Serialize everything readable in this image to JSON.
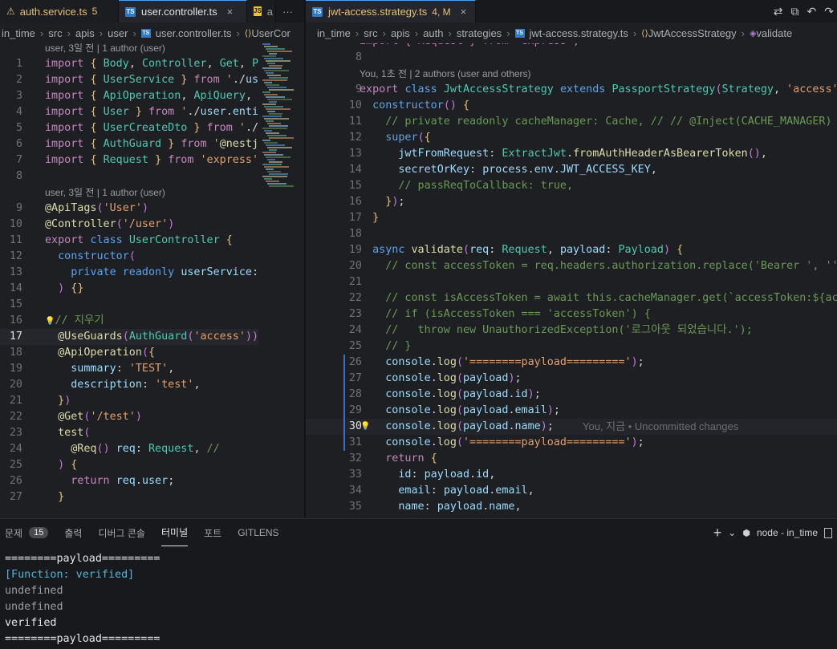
{
  "left_tabs": [
    {
      "name": "auth.service.ts",
      "badge": "5",
      "icon": "ts",
      "color": "#e5c07b"
    },
    {
      "name": "user.controller.ts",
      "icon": "ts",
      "close": "×",
      "active": true
    },
    {
      "name": "a",
      "icon": "js"
    }
  ],
  "left_overflow": "···",
  "right_tab": {
    "name": "jwt-access.strategy.ts",
    "badge": "4, M",
    "close": "×"
  },
  "top_right_icons": [
    "git-compare-icon",
    "source-control-graph-icon",
    "go-back-icon",
    "go-forward-icon"
  ],
  "left_breadcrumb": [
    "in_time",
    "src",
    "apis",
    "user",
    "user.controller.ts",
    "UserCor"
  ],
  "right_breadcrumb": [
    "in_time",
    "src",
    "apis",
    "auth",
    "strategies",
    "jwt-access.strategy.ts",
    "JwtAccessStrategy",
    "validate"
  ],
  "left_lens": [
    "user, 3일 전 | 1 author (user)",
    "user, 3일 전 | 1 author (user)"
  ],
  "right_lens": "You, 1초 전 | 2 authors (user and others)",
  "right_top_cut": "import { Request } from 'express';",
  "blame_inline": "You, 지금 • Uncommitted changes",
  "left_line_numbers": [
    "1",
    "2",
    "3",
    "4",
    "5",
    "6",
    "7",
    "8",
    "9",
    "10",
    "11",
    "12",
    "13",
    "14",
    "15",
    "16",
    "17",
    "18",
    "19",
    "20",
    "21",
    "22",
    "23",
    "24",
    "25",
    "26",
    "27"
  ],
  "right_line_numbers": [
    "8",
    "9",
    "10",
    "11",
    "12",
    "13",
    "14",
    "15",
    "16",
    "17",
    "18",
    "19",
    "20",
    "21",
    "22",
    "23",
    "24",
    "25",
    "26",
    "27",
    "28",
    "29",
    "30",
    "31",
    "32",
    "33",
    "34",
    "35"
  ],
  "left_code": [
    "import { Body, Controller, Get, Post",
    "import { UserService } from './user",
    "import { ApiOperation, ApiQuery, Ap",
    "import { User } from './user.entity",
    "import { UserCreateDto } from './use",
    "import { AuthGuard } from '@nestjs/p",
    "import { Request } from 'express';",
    "",
    "@ApiTags('User')",
    "@Controller('/user')",
    "export class UserController {",
    "  constructor(",
    "    private readonly userService: Us",
    "  ) {}",
    "",
    "// 지우기",
    "  @UseGuards(AuthGuard('access'))",
    "  @ApiOperation({",
    "    summary: 'TEST',",
    "    description: 'test',",
    "  })",
    "  @Get('/test')",
    "  test(",
    "    @Req() req: Request, //",
    "  ) {",
    "    return req.user;",
    "  }"
  ],
  "right_code": [
    "",
    "export class JwtAccessStrategy extends PassportStrategy(Strategy, 'access') {",
    "  constructor() {",
    "    // private readonly cacheManager: Cache, // // @Inject(CACHE_MANAGER)",
    "    super({",
    "      jwtFromRequest: ExtractJwt.fromAuthHeaderAsBearerToken(),",
    "      secretOrKey: process.env.JWT_ACCESS_KEY,",
    "      // passReqToCallback: true,",
    "    });",
    "  }",
    "",
    "  async validate(req: Request, payload: Payload) {",
    "    // const accessToken = req.headers.authorization.replace('Bearer ', '');",
    "",
    "    // const isAccessToken = await this.cacheManager.get(`accessToken:${accessToken}`);",
    "    // if (isAccessToken === 'accessToken') {",
    "    //   throw new UnauthorizedException('로그아웃 되었습니다.');",
    "    // }",
    "    console.log('========payload=========');",
    "    console.log(payload);",
    "    console.log(payload.id);",
    "    console.log(payload.email);",
    "    console.log(payload.name);",
    "    console.log('========payload=========');",
    "    return {",
    "      id: payload.id,",
    "      email: payload.email,",
    "      name: payload.name,"
  ],
  "panel_tabs": [
    {
      "label": "문제",
      "badge": "15"
    },
    {
      "label": "출력"
    },
    {
      "label": "디버그 콘솔"
    },
    {
      "label": "터미널",
      "active": true
    },
    {
      "label": "포트"
    },
    {
      "label": "GITLENS"
    }
  ],
  "panel_right": {
    "add": "+",
    "dropdown": "⌄",
    "terminal_name": "node - in_time"
  },
  "terminal": [
    {
      "text": "========payload=========",
      "color": "#e6e6e6"
    },
    {
      "text": "[Function: verified]",
      "color": "#4fb6d6"
    },
    {
      "text": "undefined",
      "color": "#9a9ca3"
    },
    {
      "text": "undefined",
      "color": "#9a9ca3"
    },
    {
      "text": "verified",
      "color": "#e6e6e6"
    },
    {
      "text": "========payload=========",
      "color": "#e6e6e6"
    }
  ]
}
